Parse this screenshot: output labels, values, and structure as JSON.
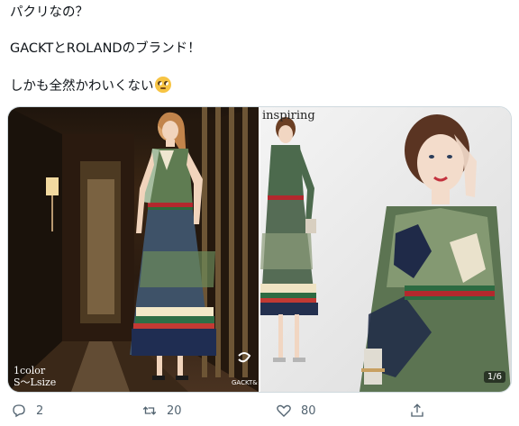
{
  "tweet": {
    "line1": "パクリなの？",
    "line2": "GACKTとROLANDのブランド！",
    "line3": "しかも全然かわいくない",
    "emoji": "face-with-rolling-eyes"
  },
  "media": {
    "image1": {
      "caption_line1": "1color",
      "caption_line2": "S～Lsize",
      "brand_text": "GACKT&"
    },
    "image2": {
      "header_text": "inspiring",
      "pager": "1/6"
    }
  },
  "actions": {
    "reply_count": "2",
    "retweet_count": "20",
    "like_count": "80"
  },
  "colors": {
    "text": "#0f1419",
    "muted": "#536471",
    "border": "#cfd9de"
  }
}
